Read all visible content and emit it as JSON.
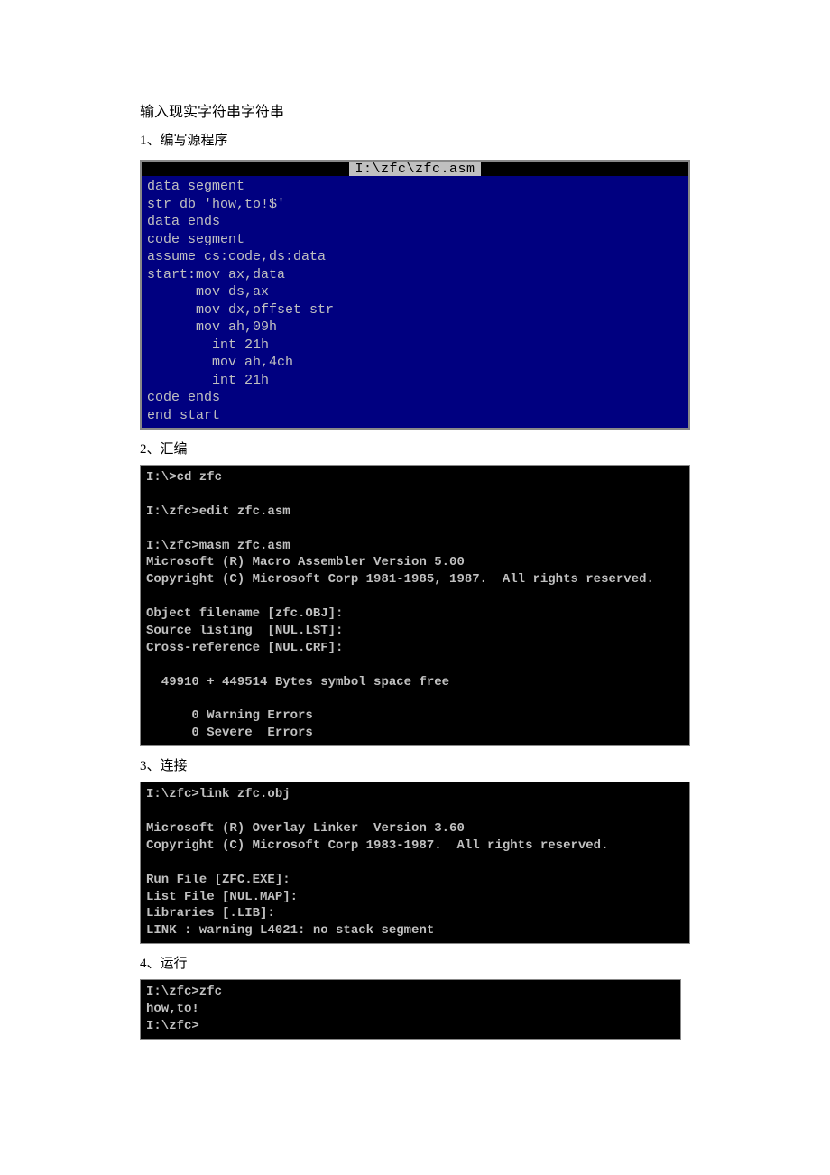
{
  "title": "输入现实字符串字符串",
  "steps": {
    "s1": "1、编写源程序",
    "s2": "2、汇编",
    "s3": "3、连接",
    "s4": "4、运行"
  },
  "editor": {
    "title": "I:\\zfc\\zfc.asm",
    "code": "data segment\nstr db 'how,to!$'\ndata ends\ncode segment\nassume cs:code,ds:data\nstart:mov ax,data\n      mov ds,ax\n      mov dx,offset str\n      mov ah,09h\n        int 21h\n        mov ah,4ch\n        int 21h\ncode ends\nend start"
  },
  "term_assemble": "I:\\>cd zfc\n\nI:\\zfc>edit zfc.asm\n\nI:\\zfc>masm zfc.asm\nMicrosoft (R) Macro Assembler Version 5.00\nCopyright (C) Microsoft Corp 1981-1985, 1987.  All rights reserved.\n\nObject filename [zfc.OBJ]:\nSource listing  [NUL.LST]:\nCross-reference [NUL.CRF]:\n\n  49910 + 449514 Bytes symbol space free\n\n      0 Warning Errors\n      0 Severe  Errors",
  "term_link": "I:\\zfc>link zfc.obj\n\nMicrosoft (R) Overlay Linker  Version 3.60\nCopyright (C) Microsoft Corp 1983-1987.  All rights reserved.\n\nRun File [ZFC.EXE]:\nList File [NUL.MAP]:\nLibraries [.LIB]:\nLINK : warning L4021: no stack segment",
  "term_run": "I:\\zfc>zfc\nhow,to!\nI:\\zfc>"
}
